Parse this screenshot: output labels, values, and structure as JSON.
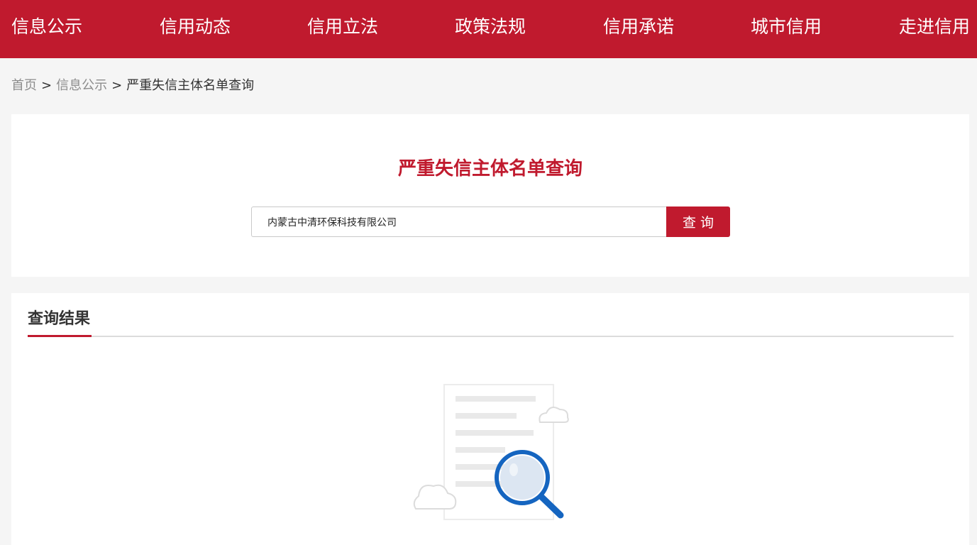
{
  "nav": {
    "items": [
      {
        "label": "信息公示"
      },
      {
        "label": "信用动态"
      },
      {
        "label": "信用立法"
      },
      {
        "label": "政策法规"
      },
      {
        "label": "信用承诺"
      },
      {
        "label": "城市信用"
      },
      {
        "label": "走进信用"
      }
    ]
  },
  "breadcrumb": {
    "home": "首页",
    "sep": ">",
    "parent": "信息公示",
    "current": "严重失信主体名单查询"
  },
  "search": {
    "title": "严重失信主体名单查询",
    "value": "内蒙古中清环保科技有限公司",
    "button_label": "查询"
  },
  "results": {
    "title": "查询结果",
    "empty_icon": "search-document-icon"
  },
  "colors": {
    "brand": "#c01a2e",
    "page_bg": "#f5f5f5",
    "magnifier": "#1565c0"
  }
}
